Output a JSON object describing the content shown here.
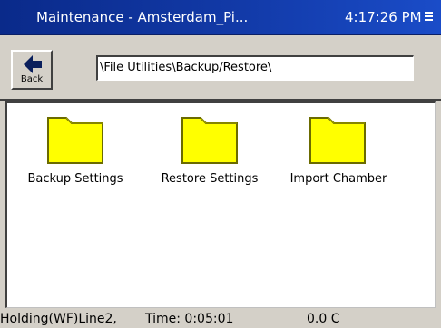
{
  "window": {
    "title": "Maintenance - Amsterdam_Pi...",
    "clock": "4:17:26 PM"
  },
  "toolbar": {
    "back_label": "Back",
    "path": "\\File Utilities\\Backup/Restore\\"
  },
  "items": [
    {
      "label": "Backup Settings",
      "icon": "folder-icon"
    },
    {
      "label": "Restore Settings",
      "icon": "folder-icon"
    },
    {
      "label": "Import Chamber",
      "icon": "folder-icon"
    }
  ],
  "status": {
    "mode": "Holding(WF)Line2,",
    "time": "Time: 0:05:01",
    "temp": "0.0 C"
  },
  "colors": {
    "titlebar": "#123aa8",
    "folder_fill": "#ffff00",
    "folder_outline": "#6b6b00"
  }
}
